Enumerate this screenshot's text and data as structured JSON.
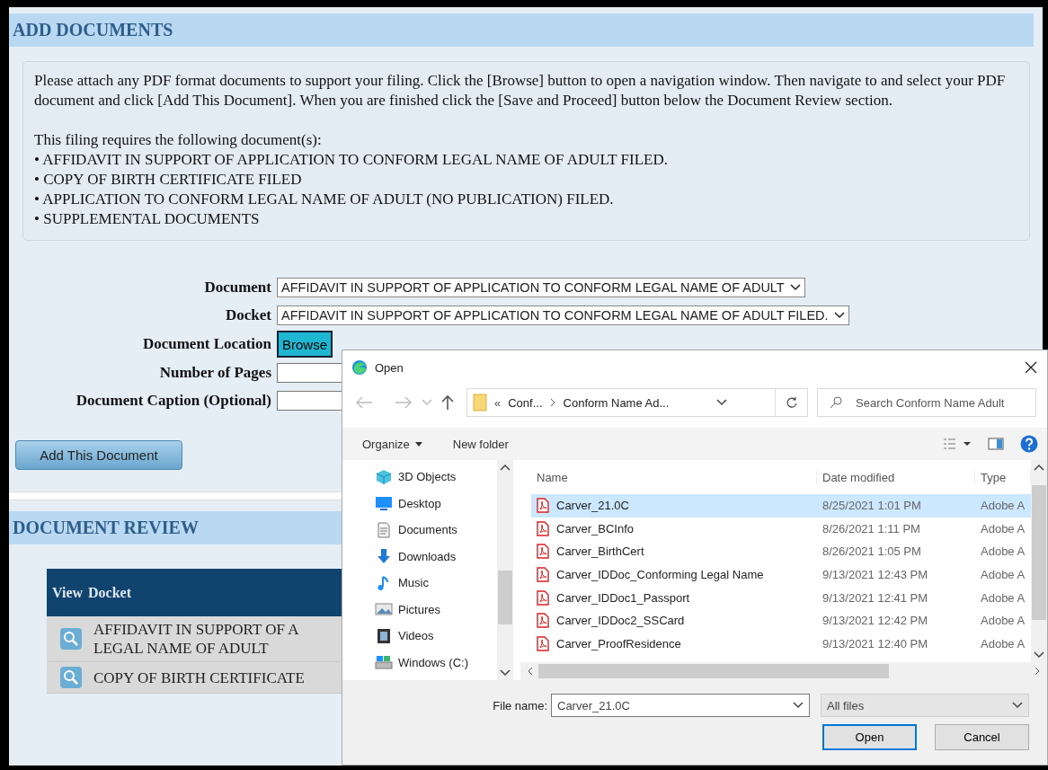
{
  "add_documents": {
    "title": "ADD DOCUMENTS",
    "instructions": "Please attach any PDF format documents to support your filing. Click the [Browse] button to open a navigation window. Then navigate to and select your PDF document and click [Add This Document]. When you are finished click the [Save and Proceed] button below the Document Review section.",
    "requirements_intro": "This filing requires the following document(s):",
    "requirements": [
      "• AFFIDAVIT IN SUPPORT OF APPLICATION TO CONFORM LEGAL NAME OF ADULT FILED.",
      "• COPY OF BIRTH CERTIFICATE FILED",
      "• APPLICATION TO CONFORM LEGAL NAME OF ADULT (NO PUBLICATION) FILED.",
      "• SUPPLEMENTAL DOCUMENTS"
    ]
  },
  "form": {
    "fields": [
      {
        "kind": "select",
        "label": "Document",
        "value": "AFFIDAVIT IN SUPPORT OF APPLICATION TO CONFORM LEGAL NAME OF ADULT"
      },
      {
        "kind": "select",
        "label": "Docket",
        "value": "AFFIDAVIT IN SUPPORT OF APPLICATION TO CONFORM LEGAL NAME OF ADULT FILED."
      },
      {
        "kind": "button",
        "label": "Document Location",
        "button": "Browse"
      },
      {
        "kind": "input",
        "label": "Number of Pages"
      },
      {
        "kind": "input",
        "label": "Document Caption (Optional)"
      }
    ],
    "add_button": "Add This Document"
  },
  "document_review": {
    "title": "DOCUMENT REVIEW",
    "columns": [
      "View",
      "Docket"
    ],
    "rows": [
      {
        "docket": "AFFIDAVIT IN SUPPORT OF A\nLEGAL NAME OF ADULT"
      },
      {
        "docket": "COPY OF BIRTH CERTIFICATE"
      }
    ]
  },
  "open_dialog": {
    "title": "Open",
    "path_overflow": "«",
    "path": [
      "Conf...",
      "Conform Name Ad..."
    ],
    "search_placeholder": "Search Conform Name Adult",
    "organize": "Organize",
    "new_folder": "New folder",
    "nav": [
      {
        "label": "3D Objects",
        "kind": "objects"
      },
      {
        "label": "Desktop",
        "kind": "desktop"
      },
      {
        "label": "Documents",
        "kind": "documents"
      },
      {
        "label": "Downloads",
        "kind": "downloads"
      },
      {
        "label": "Music",
        "kind": "music"
      },
      {
        "label": "Pictures",
        "kind": "pictures"
      },
      {
        "label": "Videos",
        "kind": "videos"
      },
      {
        "label": "Windows (C:)",
        "kind": "drive"
      }
    ],
    "columns": [
      "Name",
      "Date modified",
      "Type"
    ],
    "files": [
      {
        "name": "Carver_21.0C",
        "date": "8/25/2021 1:01 PM",
        "type": "Adobe A",
        "selected": true
      },
      {
        "name": "Carver_BCInfo",
        "date": "8/26/2021 1:11 PM",
        "type": "Adobe A",
        "selected": false
      },
      {
        "name": "Carver_BirthCert",
        "date": "8/26/2021 1:05 PM",
        "type": "Adobe A",
        "selected": false
      },
      {
        "name": "Carver_IDDoc_Conforming Legal Name",
        "date": "9/13/2021 12:43 PM",
        "type": "Adobe A",
        "selected": false
      },
      {
        "name": "Carver_IDDoc1_Passport",
        "date": "9/13/2021 12:41 PM",
        "type": "Adobe A",
        "selected": false
      },
      {
        "name": "Carver_IDDoc2_SSCard",
        "date": "9/13/2021 12:42 PM",
        "type": "Adobe A",
        "selected": false
      },
      {
        "name": "Carver_ProofResidence",
        "date": "9/13/2021 12:40 PM",
        "type": "Adobe A",
        "selected": false
      }
    ],
    "file_name_label": "File name:",
    "file_name": "Carver_21.0C",
    "filter": "All files",
    "open_button": "Open",
    "cancel_button": "Cancel"
  }
}
